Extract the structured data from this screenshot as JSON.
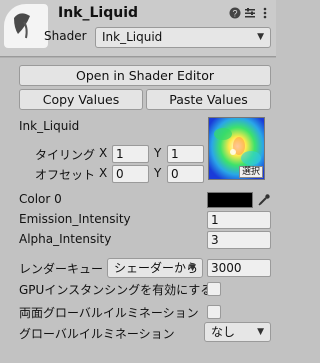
{
  "header": {
    "title": "Ink_Liquid",
    "shader_label": "Shader",
    "shader_value": "Ink_Liquid"
  },
  "buttons": {
    "open_shader_editor": "Open in Shader Editor",
    "copy_values": "Copy Values",
    "paste_values": "Paste Values"
  },
  "texture": {
    "name": "Ink_Liquid",
    "tiling_label": "タイリング",
    "offset_label": "オフセット",
    "x_label": "X",
    "y_label": "Y",
    "tiling_x": "1",
    "tiling_y": "1",
    "offset_x": "0",
    "offset_y": "0",
    "select_label": "選択"
  },
  "properties": {
    "color0_label": "Color 0",
    "color0_value": "#000000",
    "emission_label": "Emission_Intensity",
    "emission_value": "1",
    "alpha_label": "Alpha_Intensity",
    "alpha_value": "3"
  },
  "render_queue": {
    "label": "レンダーキュー",
    "dropdown_value": "シェーダーから",
    "value": "3000"
  },
  "options": {
    "gpu_instancing_label": "GPUインスタンシングを有効にする",
    "gpu_instancing_checked": false,
    "double_sided_gi_label": "両面グローバルイルミネーション",
    "double_sided_gi_checked": false,
    "gi_label": "グローバルイルミネーション",
    "gi_value": "なし"
  }
}
